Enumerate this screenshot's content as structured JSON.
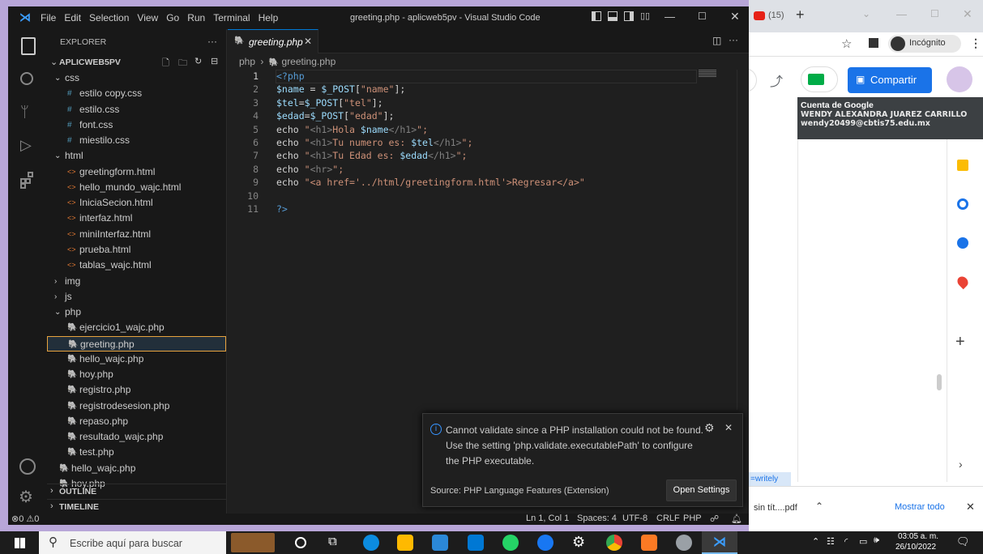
{
  "window": {
    "title": "greeting.php - aplicweb5pv - Visual Studio Code",
    "menu": [
      "File",
      "Edit",
      "Selection",
      "View",
      "Go",
      "Run",
      "Terminal",
      "Help"
    ]
  },
  "explorer": {
    "header": "EXPLORER",
    "more": "···",
    "root": "APLICWEB5PV",
    "items": [
      {
        "label": "css",
        "kind": "folder-open",
        "indent": 1
      },
      {
        "label": "estilo copy.css",
        "kind": "css",
        "indent": 2
      },
      {
        "label": "estilo.css",
        "kind": "css",
        "indent": 2
      },
      {
        "label": "font.css",
        "kind": "css",
        "indent": 2
      },
      {
        "label": "miestilo.css",
        "kind": "css",
        "indent": 2
      },
      {
        "label": "html",
        "kind": "folder-open",
        "indent": 1
      },
      {
        "label": "greetingform.html",
        "kind": "html",
        "indent": 2
      },
      {
        "label": "hello_mundo_wajc.html",
        "kind": "html",
        "indent": 2
      },
      {
        "label": "IniciaSecion.html",
        "kind": "html",
        "indent": 2
      },
      {
        "label": "interfaz.html",
        "kind": "html",
        "indent": 2
      },
      {
        "label": "miniInterfaz.html",
        "kind": "html",
        "indent": 2
      },
      {
        "label": "prueba.html",
        "kind": "html",
        "indent": 2
      },
      {
        "label": "tablas_wajc.html",
        "kind": "html",
        "indent": 2
      },
      {
        "label": "img",
        "kind": "folder",
        "indent": 1
      },
      {
        "label": "js",
        "kind": "folder",
        "indent": 1
      },
      {
        "label": "php",
        "kind": "folder-open",
        "indent": 1
      },
      {
        "label": "ejercicio1_wajc.php",
        "kind": "php",
        "indent": 2
      },
      {
        "label": "greeting.php",
        "kind": "php",
        "indent": 2,
        "selected": true
      },
      {
        "label": "hello_wajc.php",
        "kind": "php",
        "indent": 2
      },
      {
        "label": "hoy.php",
        "kind": "php",
        "indent": 2
      },
      {
        "label": "registro.php",
        "kind": "php",
        "indent": 2
      },
      {
        "label": "registrodesesion.php",
        "kind": "php",
        "indent": 2
      },
      {
        "label": "repaso.php",
        "kind": "php",
        "indent": 2
      },
      {
        "label": "resultado_wajc.php",
        "kind": "php",
        "indent": 2
      },
      {
        "label": "test.php",
        "kind": "php",
        "indent": 2
      },
      {
        "label": "hello_wajc.php",
        "kind": "php",
        "indent": 1
      },
      {
        "label": "hoy.php",
        "kind": "php",
        "indent": 1
      }
    ],
    "outline": "OUTLINE",
    "timeline": "TIMELINE"
  },
  "editor": {
    "tab": "greeting.php",
    "breadcrumb": [
      "php",
      "greeting.php"
    ],
    "lines": [
      [
        {
          "t": "<?php",
          "c": "php"
        }
      ],
      [
        {
          "t": "$name",
          "c": "var"
        },
        {
          "t": " = ",
          "c": "def"
        },
        {
          "t": "$_POST",
          "c": "var"
        },
        {
          "t": "[",
          "c": "def"
        },
        {
          "t": "\"name\"",
          "c": "str"
        },
        {
          "t": "];",
          "c": "def"
        }
      ],
      [
        {
          "t": "$tel",
          "c": "var"
        },
        {
          "t": "=",
          "c": "def"
        },
        {
          "t": "$_POST",
          "c": "var"
        },
        {
          "t": "[",
          "c": "def"
        },
        {
          "t": "\"tel\"",
          "c": "str"
        },
        {
          "t": "];",
          "c": "def"
        }
      ],
      [
        {
          "t": "$edad",
          "c": "var"
        },
        {
          "t": "=",
          "c": "def"
        },
        {
          "t": "$_POST",
          "c": "var"
        },
        {
          "t": "[",
          "c": "def"
        },
        {
          "t": "\"edad\"",
          "c": "str"
        },
        {
          "t": "];",
          "c": "def"
        }
      ],
      [
        {
          "t": "echo ",
          "c": "def"
        },
        {
          "t": "\"",
          "c": "str"
        },
        {
          "t": "<h1>",
          "c": "tag"
        },
        {
          "t": "Hola ",
          "c": "str"
        },
        {
          "t": "$name",
          "c": "var"
        },
        {
          "t": "</h1>",
          "c": "tag"
        },
        {
          "t": "\";",
          "c": "str"
        }
      ],
      [
        {
          "t": "echo ",
          "c": "def"
        },
        {
          "t": "\"",
          "c": "str"
        },
        {
          "t": "<h1>",
          "c": "tag"
        },
        {
          "t": "Tu numero es: ",
          "c": "str"
        },
        {
          "t": "$tel",
          "c": "var"
        },
        {
          "t": "</h1>",
          "c": "tag"
        },
        {
          "t": "\";",
          "c": "str"
        }
      ],
      [
        {
          "t": "echo ",
          "c": "def"
        },
        {
          "t": "\"",
          "c": "str"
        },
        {
          "t": "<h1>",
          "c": "tag"
        },
        {
          "t": "Tu Edad es: ",
          "c": "str"
        },
        {
          "t": "$edad",
          "c": "var"
        },
        {
          "t": "</h1>",
          "c": "tag"
        },
        {
          "t": "\";",
          "c": "str"
        }
      ],
      [
        {
          "t": "echo ",
          "c": "def"
        },
        {
          "t": "\"",
          "c": "str"
        },
        {
          "t": "<hr>",
          "c": "tag"
        },
        {
          "t": "\";",
          "c": "str"
        }
      ],
      [
        {
          "t": "echo ",
          "c": "def"
        },
        {
          "t": "\"",
          "c": "str"
        },
        {
          "t": "<a href='../html/greetingform.html'>",
          "c": "str"
        },
        {
          "t": "Regresar",
          "c": "str"
        },
        {
          "t": "</a>",
          "c": "str"
        },
        {
          "t": "\"",
          "c": "str"
        }
      ],
      [],
      [
        {
          "t": "?>",
          "c": "php"
        }
      ]
    ]
  },
  "notification": {
    "message": "Cannot validate since a PHP installation could not be found. Use the setting 'php.validate.executablePath' to configure the PHP executable.",
    "source": "Source: PHP Language Features (Extension)",
    "button": "Open Settings"
  },
  "status": {
    "errors": "0",
    "warnings": "0",
    "position": "Ln 1, Col 1",
    "spaces": "Spaces: 4",
    "encoding": "UTF-8",
    "eol": "CRLF",
    "language": "PHP"
  },
  "browser": {
    "tab_count": "(15)",
    "incognito": "Incógnito",
    "share": "Compartir",
    "account_title": "Cuenta de Google",
    "account_name": "WENDY ALEXANDRA JUAREZ CARRILLO",
    "account_email": "wendy20499@cbtis75.edu.mx",
    "writely": "=writely",
    "download_file": "sin tít....pdf",
    "show_all": "Mostrar todo"
  },
  "taskbar": {
    "search_placeholder": "Escribe aquí para buscar",
    "time": "03:05 a. m.",
    "date": "26/10/2022"
  }
}
